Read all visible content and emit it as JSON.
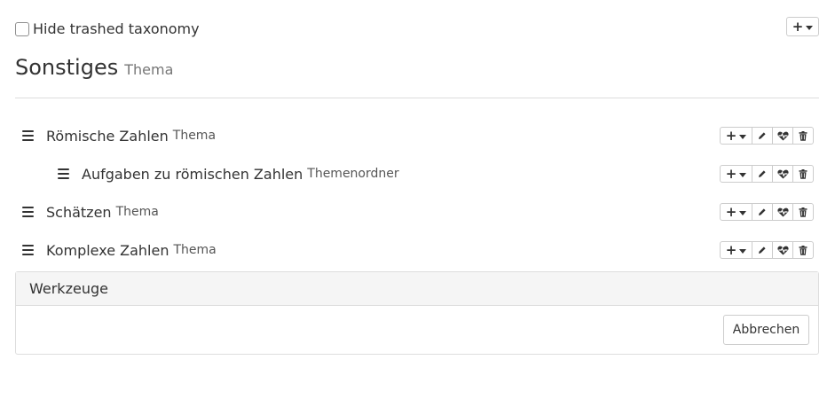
{
  "filter": {
    "hide_trashed_label": "Hide trashed taxonomy",
    "checked": false
  },
  "taxonomy": {
    "title": "Sonstiges",
    "type": "Thema"
  },
  "tree": [
    {
      "title": "Römische Zahlen",
      "type": "Thema",
      "level": 0
    },
    {
      "title": "Aufgaben zu römischen Zahlen",
      "type": "Themenordner",
      "level": 1
    },
    {
      "title": "Schätzen",
      "type": "Thema",
      "level": 0
    },
    {
      "title": "Komplexe Zahlen",
      "type": "Thema",
      "level": 0
    }
  ],
  "tools_panel": {
    "heading": "Werkzeuge",
    "cancel_label": "Abbrechen"
  },
  "icons": {
    "add": "plus-icon",
    "dropdown": "caret-down-icon",
    "edit": "pencil-icon",
    "organize": "heart-pulse-icon",
    "trash": "trash-icon",
    "drag": "drag-handle-icon"
  },
  "colors": {
    "border": "#cccccc",
    "text": "#333333",
    "muted": "#777777",
    "panel_header_bg": "#f5f5f5"
  }
}
